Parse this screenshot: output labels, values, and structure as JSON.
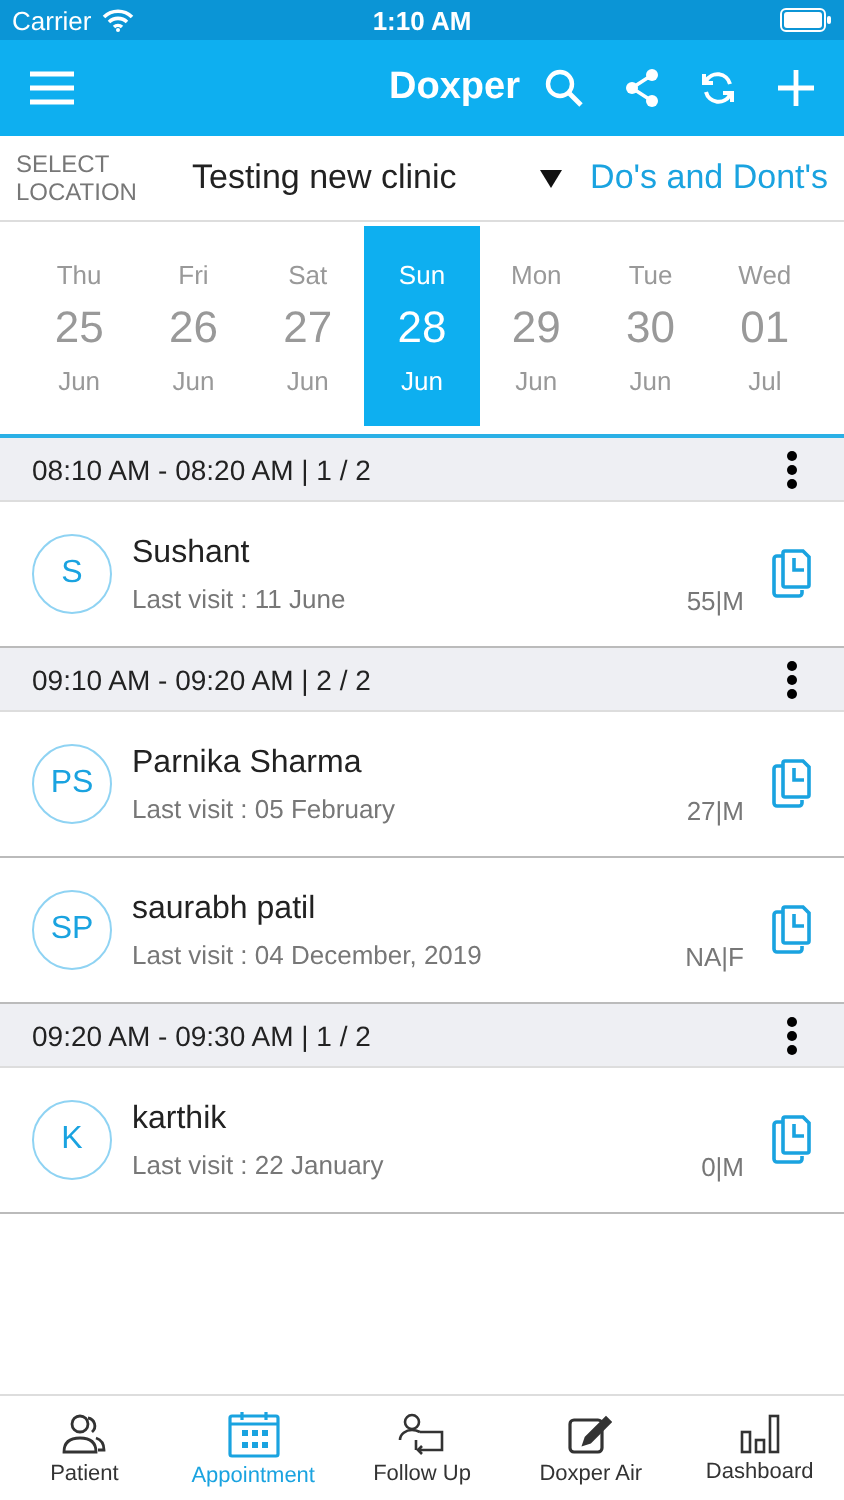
{
  "status_bar": {
    "carrier": "Carrier",
    "time": "1:10 AM"
  },
  "app_bar": {
    "title": "Doxper"
  },
  "location": {
    "label": "SELECT LOCATION",
    "value": "Testing new clinic",
    "link": "Do's and Dont's"
  },
  "dates": [
    {
      "weekday": "Thu",
      "day": "25",
      "month": "Jun",
      "selected": false
    },
    {
      "weekday": "Fri",
      "day": "26",
      "month": "Jun",
      "selected": false
    },
    {
      "weekday": "Sat",
      "day": "27",
      "month": "Jun",
      "selected": false
    },
    {
      "weekday": "Sun",
      "day": "28",
      "month": "Jun",
      "selected": true
    },
    {
      "weekday": "Mon",
      "day": "29",
      "month": "Jun",
      "selected": false
    },
    {
      "weekday": "Tue",
      "day": "30",
      "month": "Jun",
      "selected": false
    },
    {
      "weekday": "Wed",
      "day": "01",
      "month": "Jul",
      "selected": false
    }
  ],
  "slots": [
    {
      "time": "08:10 AM - 08:20 AM | 1 / 2",
      "patients": [
        {
          "initials": "S",
          "name": "Sushant",
          "last_visit": "Last visit : 11 June",
          "age_sex": "55|M"
        }
      ]
    },
    {
      "time": "09:10 AM - 09:20 AM | 2 / 2",
      "patients": [
        {
          "initials": "PS",
          "name": "Parnika Sharma",
          "last_visit": "Last visit : 05 February",
          "age_sex": "27|M"
        },
        {
          "initials": "SP",
          "name": "saurabh patil",
          "last_visit": "Last visit : 04 December, 2019",
          "age_sex": "NA|F"
        }
      ]
    },
    {
      "time": "09:20 AM - 09:30 AM | 1 / 2",
      "patients": [
        {
          "initials": "K",
          "name": "karthik",
          "last_visit": "Last visit : 22 January",
          "age_sex": "0|M"
        }
      ]
    }
  ],
  "tab_bar": [
    {
      "kind": "patient",
      "label": "Patient",
      "selected": false
    },
    {
      "kind": "appointment",
      "label": "Appointment",
      "selected": true
    },
    {
      "kind": "followup",
      "label": "Follow Up",
      "selected": false
    },
    {
      "kind": "air",
      "label": "Doxper Air",
      "selected": false
    },
    {
      "kind": "dashboard",
      "label": "Dashboard",
      "selected": false
    }
  ]
}
